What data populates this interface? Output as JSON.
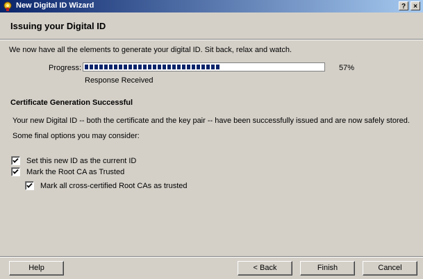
{
  "window": {
    "title": "New Digital ID Wizard",
    "help_button": "?",
    "close_button": "×"
  },
  "page": {
    "title": "Issuing your Digital ID",
    "intro": "We now have all the elements to generate your digital ID. Sit back, relax and watch."
  },
  "progress": {
    "label": "Progress:",
    "percent": 57,
    "percent_text": "57%",
    "status": "Response Received"
  },
  "result": {
    "heading": "Certificate Generation Successful",
    "description": "Your new Digital ID -- both the certificate and the key pair -- have been successfully issued and are now safely stored.",
    "options_intro": "Some final options you may consider:"
  },
  "options": [
    {
      "label": "Set this new ID as the current ID",
      "checked": true
    },
    {
      "label": "Mark the Root CA as Trusted",
      "checked": true
    },
    {
      "label": "Mark all cross-certified Root CAs as trusted",
      "checked": true
    }
  ],
  "buttons": {
    "help": "Help",
    "back": "< Back",
    "finish": "Finish",
    "cancel": "Cancel"
  },
  "colors": {
    "titlebar_start": "#0a246a",
    "titlebar_end": "#a6caf0",
    "progress": "#0a246a",
    "face": "#d4d0c8"
  }
}
